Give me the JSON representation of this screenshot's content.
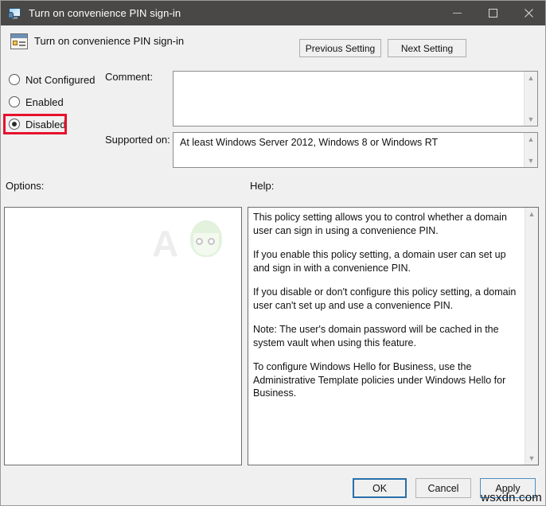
{
  "window": {
    "title": "Turn on convenience PIN sign-in",
    "icon": "policy-monitor-icon",
    "controls": {
      "minimize": "minimize-icon",
      "maximize": "maximize-icon",
      "close": "close-icon"
    }
  },
  "header": {
    "policy_name": "Turn on convenience PIN sign-in",
    "icon": "policy-setting-icon",
    "previous_setting_label": "Previous Setting",
    "next_setting_label": "Next Setting"
  },
  "state_options": [
    {
      "id": "not-configured",
      "label": "Not Configured",
      "selected": false
    },
    {
      "id": "enabled",
      "label": "Enabled",
      "selected": false
    },
    {
      "id": "disabled",
      "label": "Disabled",
      "selected": true
    }
  ],
  "comment": {
    "label": "Comment:",
    "value": "",
    "placeholder": ""
  },
  "supported_on": {
    "label": "Supported on:",
    "value": "At least Windows Server 2012, Windows 8 or Windows RT"
  },
  "options": {
    "label": "Options:",
    "content": ""
  },
  "help": {
    "label": "Help:",
    "paragraphs": [
      "This policy setting allows you to control whether a domain user can sign in using a convenience PIN.",
      "If you enable this policy setting, a domain user can set up and sign in with a convenience PIN.",
      "If you disable or don't configure this policy setting, a domain user can't set up and use a convenience PIN.",
      "Note: The user's domain password will be cached in the system vault when using this feature.",
      "To configure Windows Hello for Business, use the Administrative Template policies under Windows Hello for Business."
    ]
  },
  "footer": {
    "ok_label": "OK",
    "cancel_label": "Cancel",
    "apply_label": "Apply"
  },
  "annotations": {
    "highlight_target": "Disabled",
    "highlight_color": "#e8112d"
  },
  "watermarks": {
    "brand": "A",
    "site": "wsxdn.com"
  },
  "colors": {
    "titlebar_bg": "#4a4846",
    "dialog_bg": "#f0f0f0",
    "panel_bg": "#ffffff",
    "accent_focus": "#2a6fa8",
    "annotation_red": "#e8112d"
  }
}
